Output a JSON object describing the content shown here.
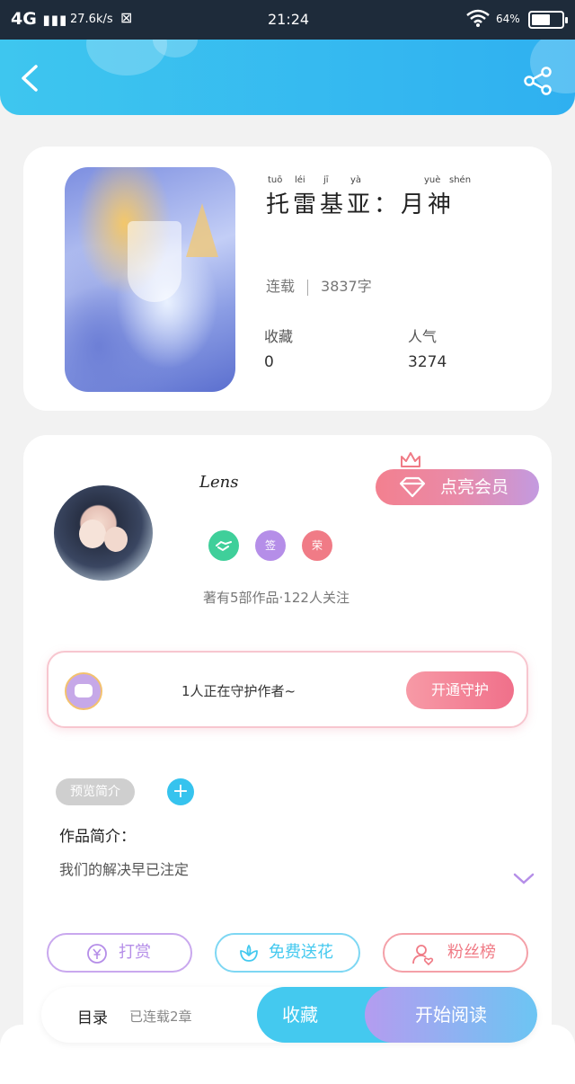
{
  "status_bar": {
    "network": "4G",
    "speed": "27.6k/s",
    "time": "21:24",
    "battery_text": "64%",
    "battery_level": 0.64
  },
  "book": {
    "title": "托雷基亚：月神",
    "ruby": [
      "tuō",
      "léi",
      "jī",
      "yà",
      "yuè",
      "shén"
    ],
    "status": "连载",
    "word_count": "3837字",
    "collect_label": "收藏",
    "collect_value": "0",
    "popularity_label": "人气",
    "popularity_value": "3274"
  },
  "author": {
    "name": "Lens",
    "badges": [
      {
        "icon": "handshake-icon",
        "color": "#3fcf9a"
      },
      {
        "text": "签",
        "color": "#b58ee8"
      },
      {
        "text": "荣",
        "color": "#f07b86"
      }
    ],
    "meta": "著有5部作品·122人关注",
    "vip_button": "点亮会员"
  },
  "guard": {
    "text": "1人正在守护作者~",
    "button": "开通守护"
  },
  "tags": [
    "预览简介"
  ],
  "intro": {
    "title": "作品简介：",
    "body": "我们的解决早已注定"
  },
  "actions": [
    {
      "label": "打赏",
      "icon": "yen-icon",
      "color": "#b58ee8"
    },
    {
      "label": "免费送花",
      "icon": "flower-icon",
      "color": "#44c9ef"
    },
    {
      "label": "粉丝榜",
      "icon": "fans-icon",
      "color": "#f07b86"
    }
  ],
  "bottom_bar": {
    "toc": "目录",
    "toc_sub": "已连载2章",
    "collect": "收藏",
    "read": "开始阅读"
  }
}
